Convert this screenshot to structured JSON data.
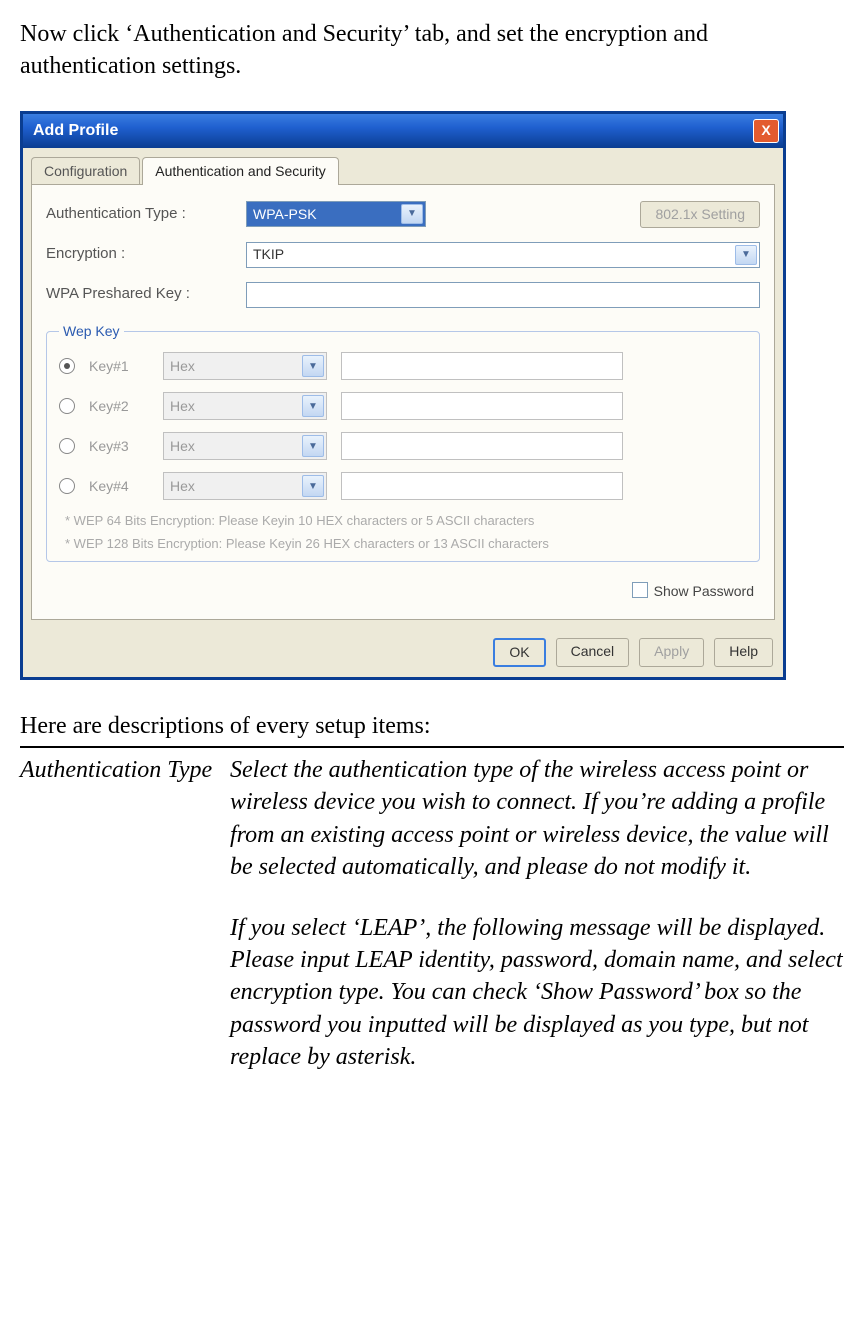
{
  "intro": "Now click ‘Authentication and Security’ tab, and set the encryption and authentication settings.",
  "dialog": {
    "title": "Add Profile",
    "close": "X",
    "tabs": {
      "configuration": "Configuration",
      "auth": "Authentication and Security"
    },
    "fields": {
      "auth_type_label": "Authentication Type :",
      "auth_type_value": "WPA-PSK",
      "encryption_label": "Encryption :",
      "encryption_value": "TKIP",
      "psk_label": "WPA Preshared Key :",
      "btn_8021x": "802.1x Setting"
    },
    "wep": {
      "legend": "Wep Key",
      "rows": [
        {
          "label": "Key#1",
          "type": "Hex",
          "selected": true
        },
        {
          "label": "Key#2",
          "type": "Hex",
          "selected": false
        },
        {
          "label": "Key#3",
          "type": "Hex",
          "selected": false
        },
        {
          "label": "Key#4",
          "type": "Hex",
          "selected": false
        }
      ],
      "hint1": "* WEP 64 Bits Encryption: Please Keyin 10 HEX characters or 5 ASCII characters",
      "hint2": "* WEP 128 Bits Encryption: Please Keyin 26 HEX characters or 13 ASCII characters"
    },
    "show_password": "Show Password",
    "buttons": {
      "ok": "OK",
      "cancel": "Cancel",
      "apply": "Apply",
      "help": "Help"
    }
  },
  "descriptions": {
    "header": "Here are descriptions of every setup items:",
    "row1_name": "Authentication Type",
    "row1_p1": "Select the authentication type of the wireless access point or wireless device you wish to connect. If you’re adding a profile from an existing access point or wireless device, the value will be selected automatically, and please do not modify it.",
    "row1_p2": "If you select ‘LEAP’, the following message will be displayed. Please input LEAP identity, password, domain name, and select encryption type. You can check ‘Show Password’ box so the password you inputted will be displayed as you type, but not replace by asterisk."
  }
}
